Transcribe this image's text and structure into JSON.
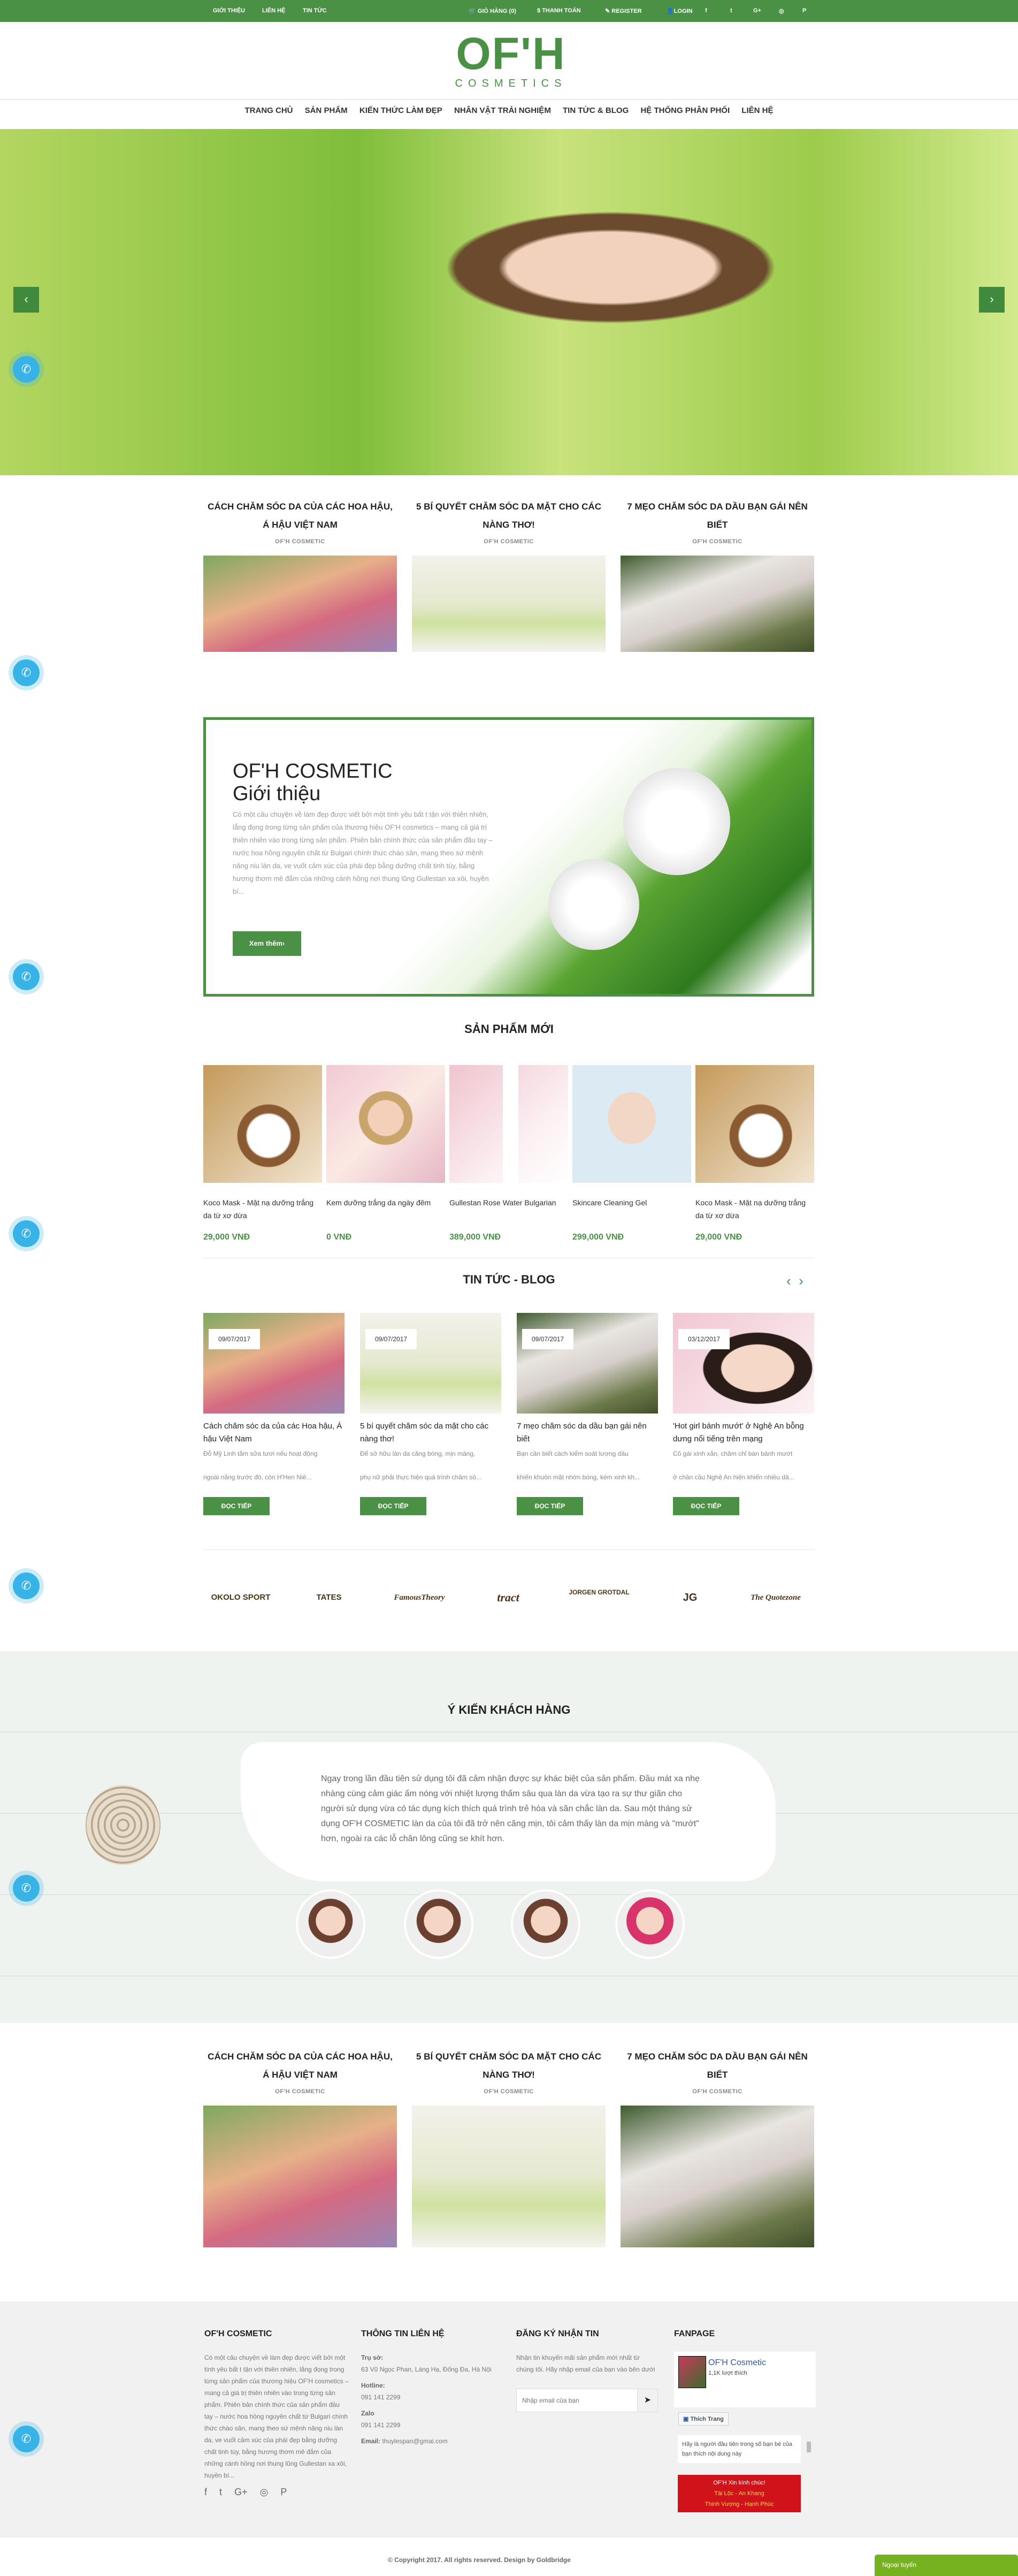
{
  "topbar": {
    "links": [
      "GIỚI THIỆU",
      "LIÊN HỆ",
      "TIN TỨC"
    ],
    "cart": "GIỎ HÀNG (0)",
    "checkout": "THANH TOÁN",
    "register": "REGISTER",
    "login": "LOGIN"
  },
  "logo": {
    "mark": "OF'H",
    "sub": "COSMETICS"
  },
  "nav": [
    "TRANG CHỦ",
    "SẢN PHẨM",
    "KIẾN THỨC LÀM ĐẸP",
    "NHÂN VẬT TRẢI NGHIỆM",
    "TIN TỨC & BLOG",
    "HỆ THỐNG PHÂN PHỐI",
    "LIÊN HỆ"
  ],
  "hero": {
    "prev": "‹",
    "next": "›"
  },
  "featured_posts": [
    {
      "title": "CÁCH CHĂM SÓC DA CỦA CÁC HOA HẬU, Á HẬU VIỆT NAM",
      "author": "OF'H COSMETIC"
    },
    {
      "title": "5 BÍ QUYẾT CHĂM SÓC DA MẶT CHO CÁC NÀNG THƠ!",
      "author": "OF'H COSMETIC"
    },
    {
      "title": "7 MẸO CHĂM SÓC DA DẦU BẠN GÁI NÊN BIẾT",
      "author": "OF'H COSMETIC"
    }
  ],
  "intro": {
    "title1": "OF'H COSMETIC",
    "title2": "Giới thiệu",
    "text": "Có một câu chuyện về làm đẹp được viết bởi một tình yêu bất t tận với thiên nhiên, lắng đọng trong từng sản phẩm của thương hiệu OF'H cosmetics – mang cả giá trị thiên nhiên vào trong từng sản phẩm. Phiên bản chính thức của sản phẩm đầu tay – nước hoa hồng nguyên chất từ Bulgari chính thức chào sân, mang theo sứ mệnh nâng niu làn da, ve vuốt cảm xúc của phái đẹp bằng dưỡng chất tinh túy, bằng hương thơm mê đắm của những cánh hồng nơi thung lũng Gullestan xa xôi, huyền bí...",
    "button": "Xem thêm›"
  },
  "products": {
    "title": "SẢN PHẨM MỚI",
    "items": [
      {
        "name": "Koco Mask - Mặt nạ dưỡng trắng da từ xơ dừa",
        "price": "29,000 VNĐ"
      },
      {
        "name": "Kem dưỡng trắng da ngày đêm",
        "price": "0 VNĐ"
      },
      {
        "name": "Gullestan Rose Water Bulgarian",
        "price": "389,000 VNĐ"
      },
      {
        "name": "Skincare Cleaning Gel",
        "price": "299,000 VNĐ"
      },
      {
        "name": "Koco Mask - Mặt nạ dưỡng trắng da từ xơ dừa",
        "price": "29,000 VNĐ"
      }
    ]
  },
  "blog": {
    "title": "TIN TỨC - BLOG",
    "prev": "‹",
    "next": "›",
    "read_more": "ĐỌC TIẾP",
    "items": [
      {
        "date": "09/07/2017",
        "title": "Cách chăm sóc da của các Hoa hậu, Á hậu Việt Nam",
        "excerpt1": "Đỗ Mỹ Linh tắm sữa tươi nếu hoạt động",
        "excerpt2": "ngoài nắng trước đó, còn H'Hen Niê..."
      },
      {
        "date": "09/07/2017",
        "title": "5 bí quyết chăm sóc da mặt cho các nàng thơ!",
        "excerpt1": "Để sở hữu làn da căng bóng, mịn màng,",
        "excerpt2": "phụ nữ phải thực hiện quá trình chăm só..."
      },
      {
        "date": "09/07/2017",
        "title": "7 mẹo chăm sóc da dầu bạn gái nên biết",
        "excerpt1": "Bạn cần biết cách kiểm soát lượng dầu",
        "excerpt2": "khiến khuôn mặt nhờn bóng, kém xinh kh..."
      },
      {
        "date": "03/12/2017",
        "title": "'Hot girl bánh mướt' ở Nghệ An bỗng dưng nổi tiếng trên mạng",
        "excerpt1": "Cô gái xinh xắn, chăm chỉ bán bánh mướt",
        "excerpt2": "ở chân cầu Nghệ An hiện khiến nhiều dâ..."
      }
    ]
  },
  "brands": [
    "OKOLO SPORT",
    "TATES",
    "FamousTheory",
    "tract",
    "JORGEN GROTDAL",
    "JG",
    "The Quotezone"
  ],
  "testimonial": {
    "title": "Ý KIẾN KHÁCH HÀNG",
    "text": "Ngay trong lần đầu tiên sử dụng tôi đã cảm nhận được sự khác biệt của sản phẩm. Đầu mát xa nhẹ nhàng cùng cảm giác ấm nóng với nhiệt lượng thấm sâu qua làn da vừa tạo ra sự thư giãn cho người sử dụng vừa có tác dụng kích thích quá trình trẻ hóa và săn chắc làn da. Sau một tháng sử dụng OF'H COSMETIC làn da của tôi đã trở nên căng mịn, tôi cảm thấy làn da mịn màng và \"mướt\" hơn, ngoài ra các lỗ chân lông cũng se khít hơn."
  },
  "footer": {
    "about": {
      "title": "OF'H COSMETIC",
      "text": "Có một câu chuyện về làm đẹp được viết bởi một tình yêu bất t tận với thiên nhiên, lắng đọng trong từng sản phẩm của thương hiệu OF'H cosmetics – mang cả giá trị thiên nhiên vào trong từng sản phẩm. Phiên bản chính thức của sản phẩm đầu tay – nước hoa hồng nguyên chất từ Bulgari chính thức chào sân, mang theo sứ mệnh nâng niu làn da, ve vuốt cảm xúc của phái đẹp bằng dưỡng chất tinh túy, bằng hương thơm mê đắm của những cánh hồng nơi thung lũng Gullestan xa xôi, huyền bí..."
    },
    "contact": {
      "title": "THÔNG TIN LIÊN HỆ",
      "addr_label": "Trụ sở:",
      "addr": "63 Vũ Ngọc Phan, Láng Hạ, Đống Đa, Hà Nội",
      "hotline_label": "Hotline:",
      "hotline": "091 141 2299",
      "zalo_label": "Zalo",
      "zalo": "091 141 2299",
      "email_label": "Email:",
      "email": "thuylespan@gmai.com"
    },
    "newsletter": {
      "title": "ĐĂNG KÝ NHẬN TIN",
      "text": "Nhận tin khuyến mãi sản phẩm mới nhất từ chúng tôi. Hãy nhập email của bạn vào bên dưới",
      "placeholder": "Nhập email của bạn"
    },
    "fanpage": {
      "title": "FANPAGE",
      "page_name": "OF'H Cosmetic",
      "likes": "1,1K lượt thích",
      "like_btn": "Thích Trang",
      "friends": "Hãy là người đầu tiên trong số bạn bè của bạn thích nội dung này",
      "banner1": "OF'H Xin kính chúc!",
      "banner2": "Tài Lộc - An Khang",
      "banner3": "Thịnh Vượng - Hạnh Phúc"
    }
  },
  "copyright": "© Copyright 2017. All rights reserved. Design by Goldbridge",
  "chat": "Ngoại tuyến",
  "colors": {
    "brand": "#4a9146",
    "phone": "#38b3e8",
    "chat": "#76b21f"
  }
}
